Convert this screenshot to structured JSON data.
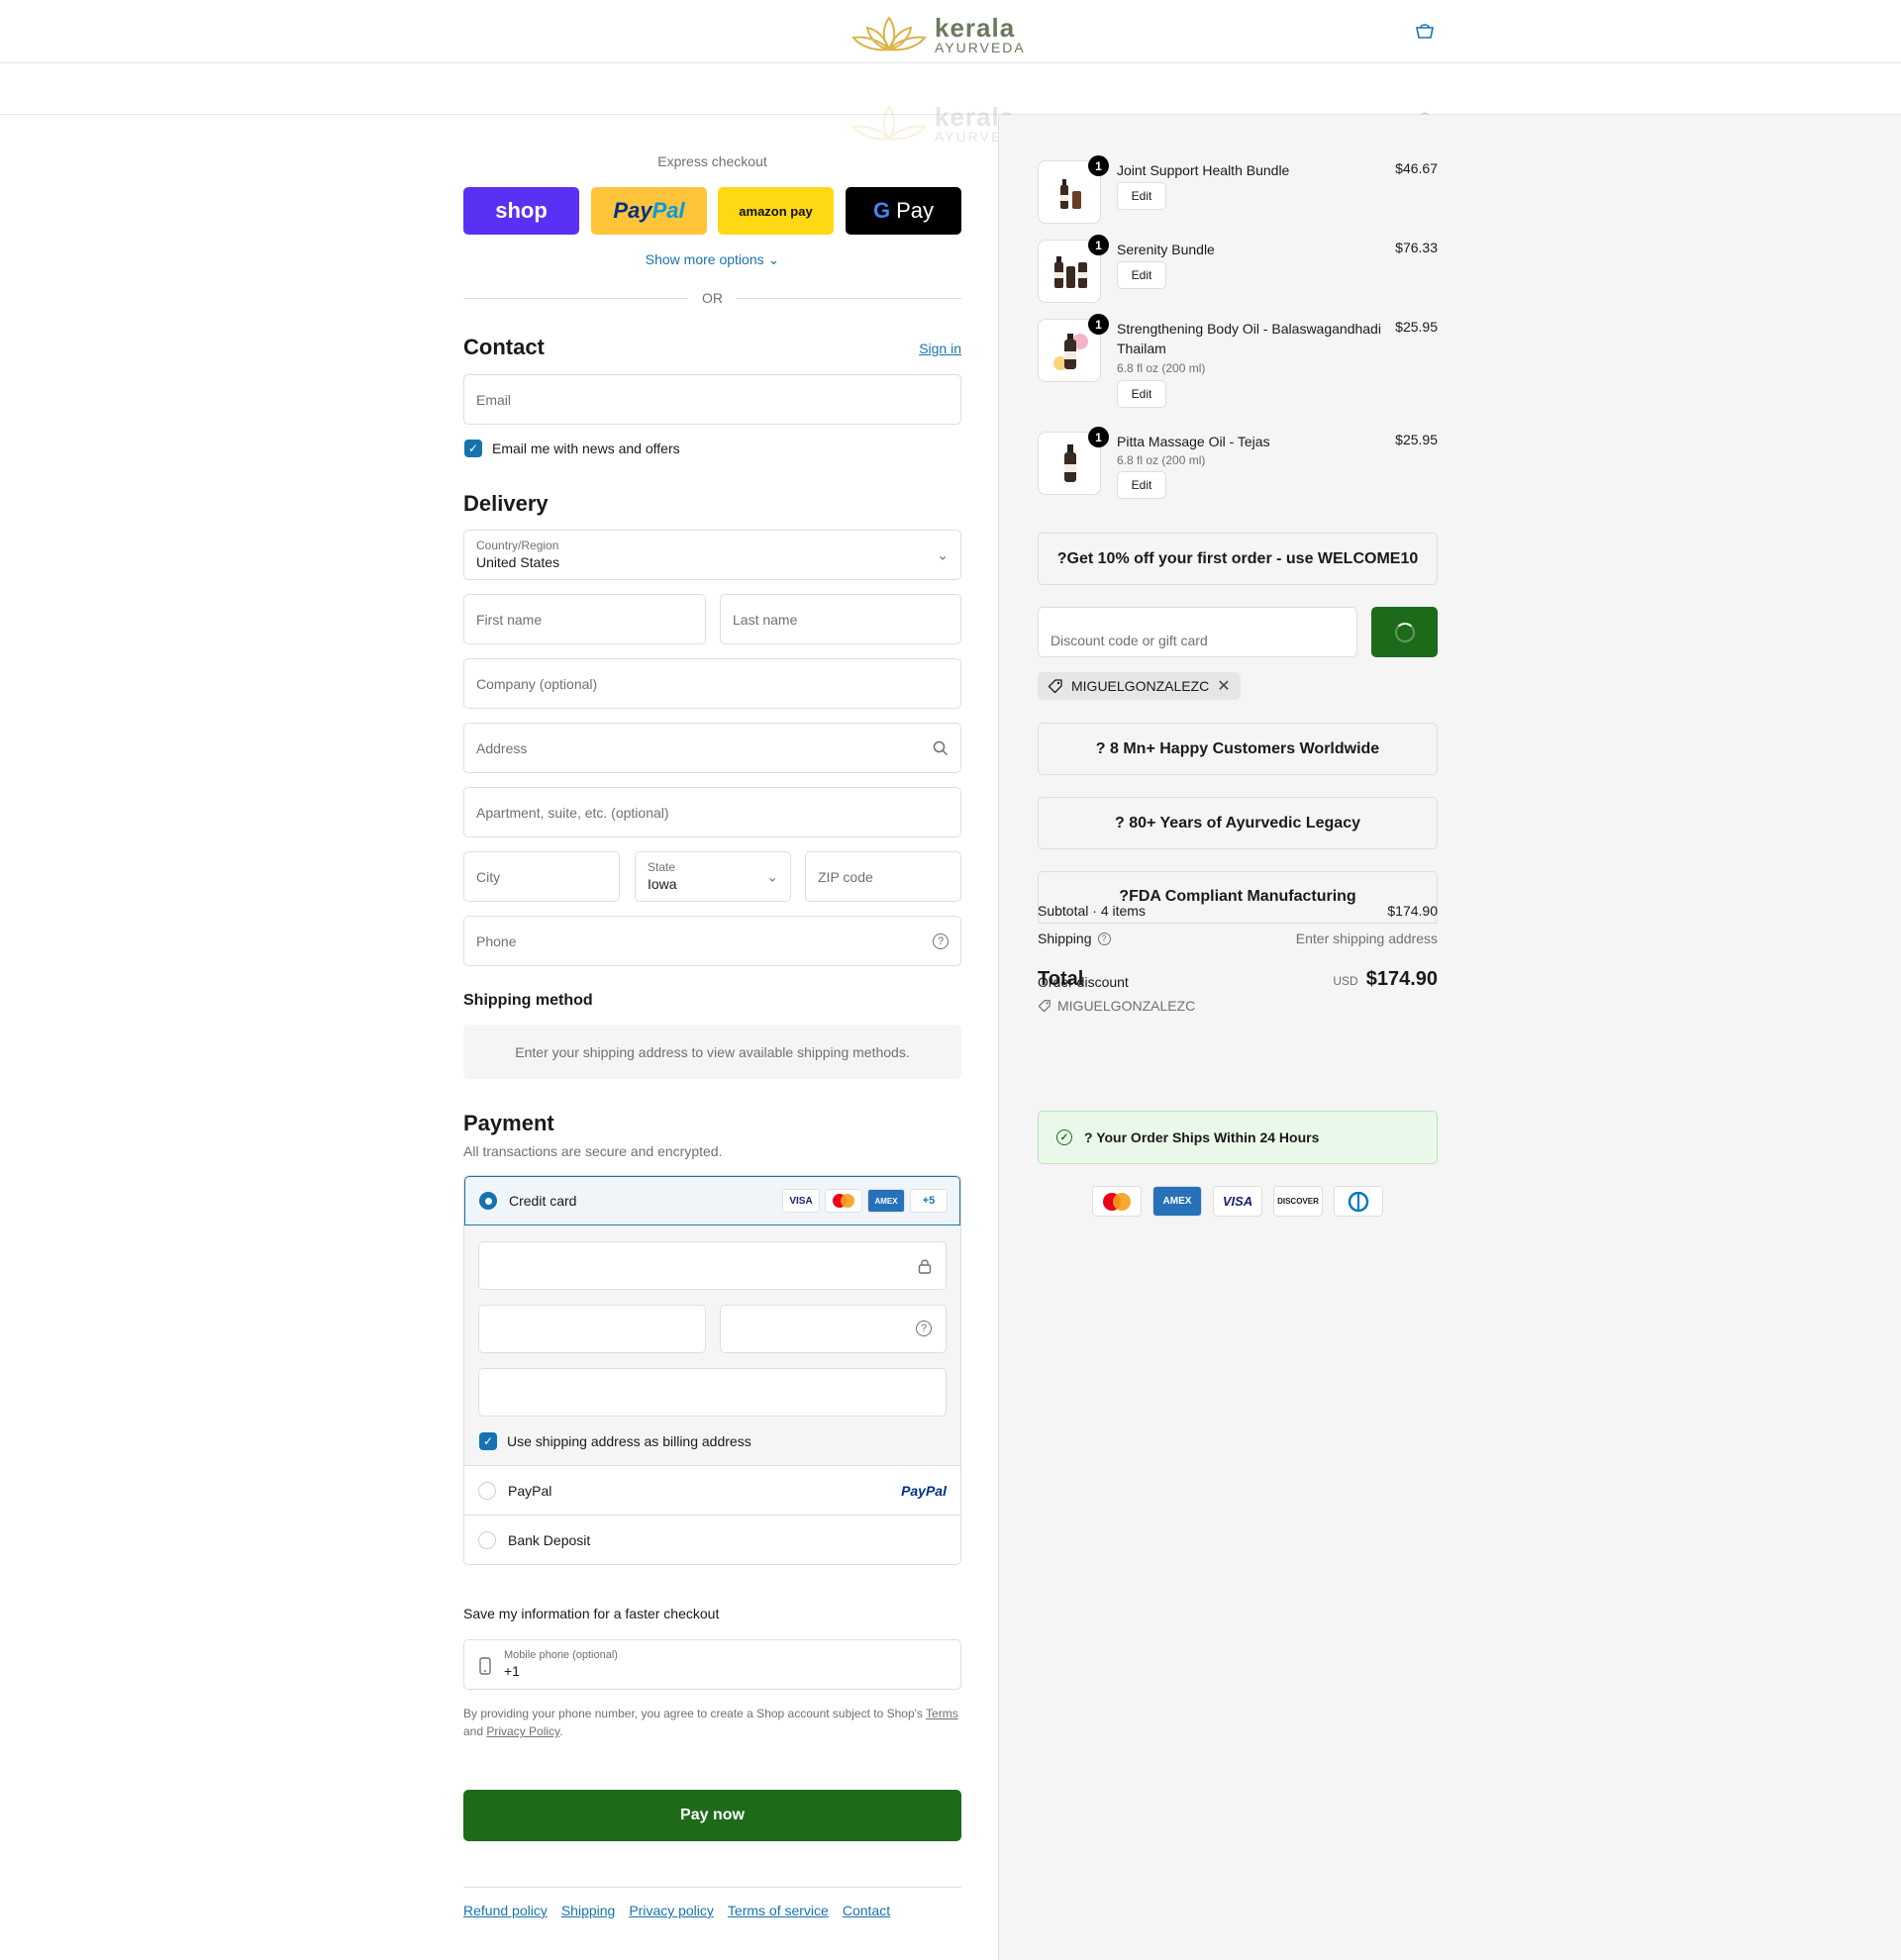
{
  "header": {
    "brand": "kerala",
    "brand_sub": "AYURVEDA"
  },
  "express": {
    "title": "Express checkout",
    "shop_label": "shop",
    "paypal_pay": "Pay",
    "paypal_pal": "Pal",
    "amazon_label": "amazon pay",
    "gpay_g": "G",
    "gpay_label": "Pay",
    "show_more": "Show more options ⌄",
    "or": "OR"
  },
  "contact": {
    "heading": "Contact",
    "sign_in": "Sign in",
    "email_placeholder": "Email",
    "news_label": "Email me with news and offers",
    "news_checked": true
  },
  "delivery": {
    "heading": "Delivery",
    "country_label": "Country/Region",
    "country_value": "United States",
    "first_name": "First name",
    "last_name": "Last name",
    "company": "Company (optional)",
    "address": "Address",
    "apartment": "Apartment, suite, etc. (optional)",
    "city": "City",
    "state_label": "State",
    "state_value": "Iowa",
    "zip": "ZIP code",
    "phone": "Phone"
  },
  "shipping_method": {
    "heading": "Shipping method",
    "message": "Enter your shipping address to view available shipping methods."
  },
  "payment": {
    "heading": "Payment",
    "subtitle": "All transactions are secure and encrypted.",
    "credit_card_label": "Credit card",
    "card_logos": [
      "VISA",
      "MC",
      "AMEX",
      "+5"
    ],
    "billing_same_label": "Use shipping address as billing address",
    "paypal_label": "PayPal",
    "paypal_logo": "PayPal",
    "bank_label": "Bank Deposit"
  },
  "save_info": {
    "heading": "Save my information for a faster checkout",
    "mobile_label": "Mobile phone (optional)",
    "mobile_value": "+1",
    "legal_prefix": "By providing your phone number, you agree to create a Shop account subject to Shop's ",
    "legal_terms": "Terms",
    "legal_and": "and ",
    "legal_privacy": "Privacy Policy",
    "legal_end": "."
  },
  "pay_now": "Pay now",
  "footer_links": [
    "Refund policy",
    "Shipping",
    "Privacy policy",
    "Terms of service",
    "Contact"
  ],
  "cart": {
    "items": [
      {
        "name": "Joint Support Health Bundle",
        "variant": "",
        "price": "$46.67",
        "qty": "1",
        "edit": "Edit"
      },
      {
        "name": "Serenity Bundle",
        "variant": "",
        "price": "$76.33",
        "qty": "1",
        "edit": "Edit"
      },
      {
        "name": "Strengthening Body Oil - Balaswagandhadi Thailam",
        "variant": "6.8 fl oz (200 ml)",
        "price": "$25.95",
        "qty": "1",
        "edit": "Edit"
      },
      {
        "name": "Pitta Massage Oil - Tejas",
        "variant": "6.8 fl oz (200 ml)",
        "price": "$25.95",
        "qty": "1",
        "edit": "Edit"
      }
    ],
    "promo_banner": "?Get 10% off your first order - use WELCOME10",
    "discount_placeholder": "Discount code or gift card",
    "applied_code": "MIGUELGONZALEZC",
    "trust_1": "? 8 Mn+ Happy Customers Worldwide",
    "trust_2": "? 80+ Years of Ayurvedic Legacy",
    "trust_3": "?FDA Compliant Manufacturing",
    "subtotal_label": "Subtotal · 4 items",
    "subtotal_value": "$174.90",
    "shipping_label": "Shipping",
    "shipping_value": "Enter shipping address",
    "order_discount_label": "Order discount",
    "order_discount_code": "MIGUELGONZALEZC",
    "total_label": "Total",
    "total_currency": "USD",
    "total_value": "$174.90",
    "ships_banner": "? Your Order Ships Within 24 Hours",
    "payment_icons": [
      "MC",
      "AMEX",
      "VISA",
      "DISCOVER",
      "DINERS"
    ]
  },
  "colors": {
    "accent": "#1773b0",
    "pay_now": "#1d6b1a",
    "shop": "#5a31f4",
    "paypal": "#ffc439",
    "amazon": "#ffd814"
  }
}
